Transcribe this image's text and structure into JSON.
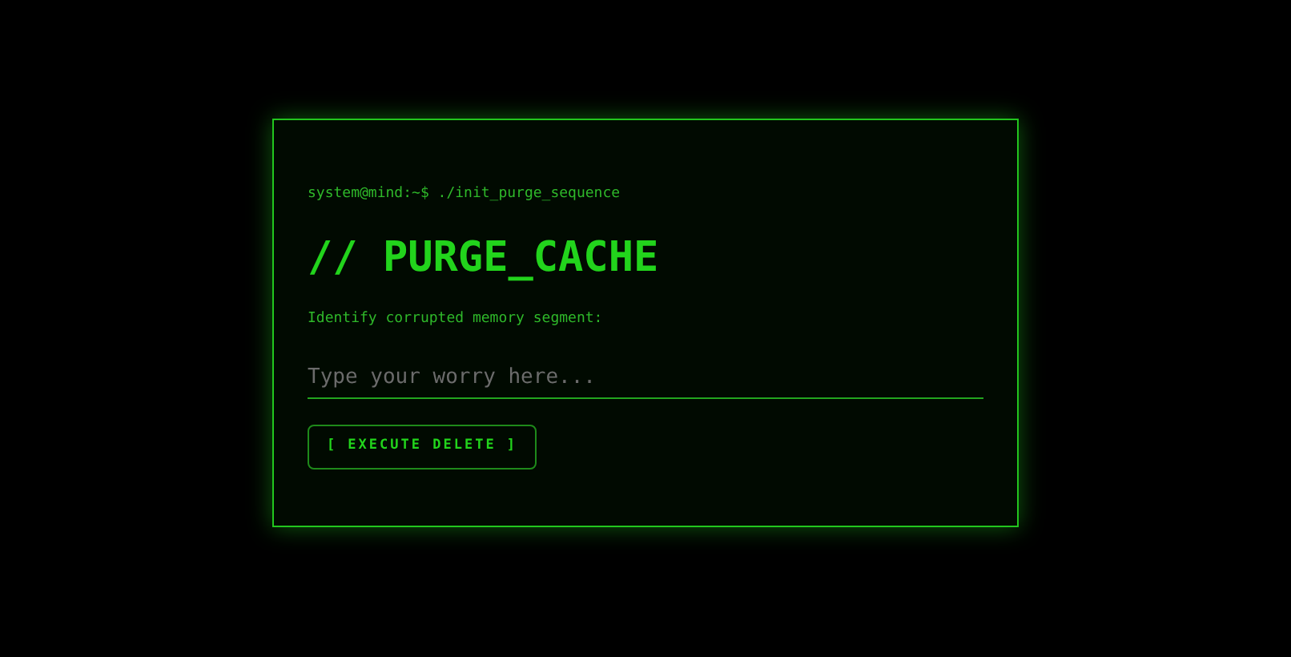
{
  "prompt": "system@mind:~$ ./init_purge_sequence",
  "title": "// PURGE_CACHE",
  "label": "Identify corrupted memory segment:",
  "input": {
    "placeholder": "Type your worry here..."
  },
  "button": "[ EXECUTE DELETE ]"
}
